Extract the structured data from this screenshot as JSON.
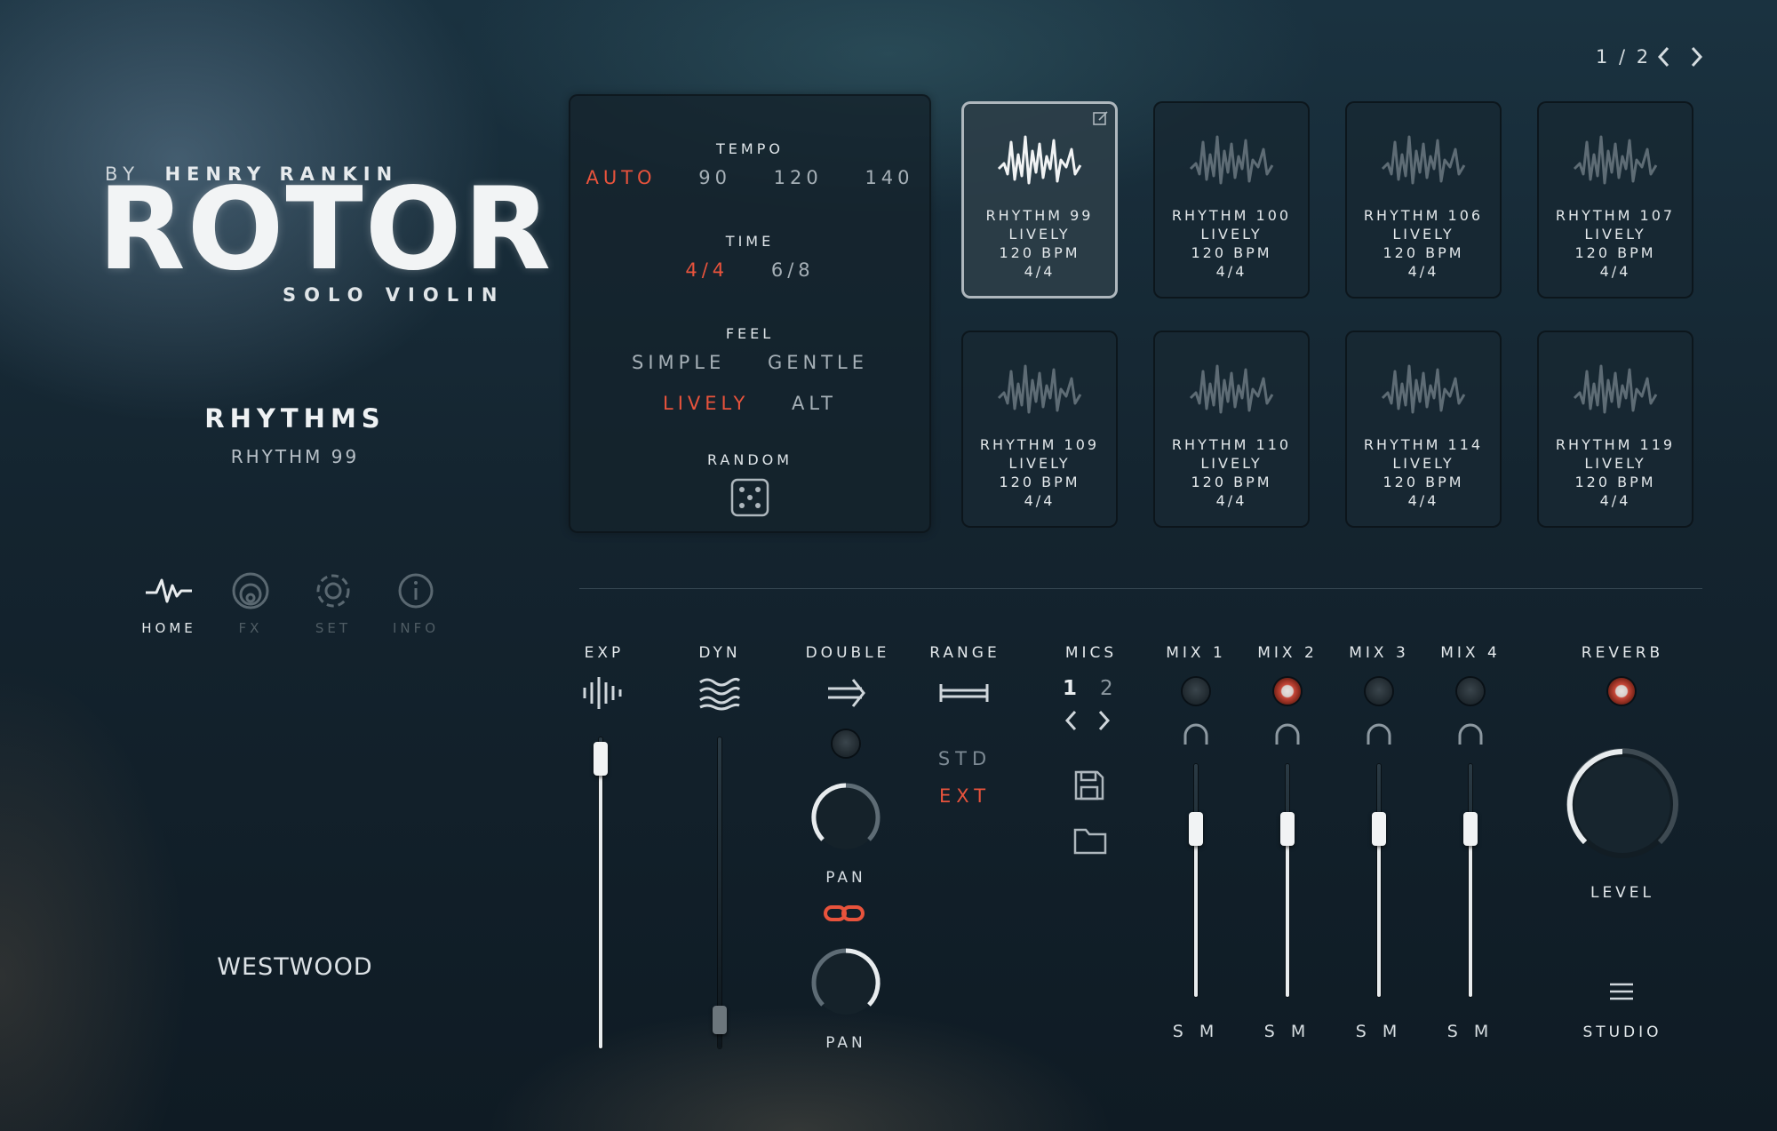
{
  "brand": {
    "by_prefix": "BY",
    "author": "HENRY RANKIN",
    "product": "ROTOR",
    "subtitle": "SOLO VIOLIN",
    "company": "WESTWOOD"
  },
  "section": {
    "title": "RHYTHMS",
    "current": "RHYTHM 99"
  },
  "nav": [
    {
      "label": "HOME",
      "icon": "waveform-icon",
      "active": true
    },
    {
      "label": "FX",
      "icon": "fx-icon",
      "active": false
    },
    {
      "label": "SET",
      "icon": "gear-icon",
      "active": false
    },
    {
      "label": "INFO",
      "icon": "info-icon",
      "active": false
    }
  ],
  "options": {
    "tempo": {
      "label": "TEMPO",
      "items": [
        "AUTO",
        "90",
        "120",
        "140"
      ],
      "selected": "AUTO"
    },
    "time": {
      "label": "TIME",
      "items": [
        "4/4",
        "6/8"
      ],
      "selected": "4/4"
    },
    "feel": {
      "label": "FEEL",
      "items": [
        "SIMPLE",
        "GENTLE",
        "LIVELY",
        "ALT"
      ],
      "selected": "LIVELY"
    },
    "random": {
      "label": "RANDOM",
      "icon": "dice-icon"
    }
  },
  "pager": {
    "text": "1 / 2"
  },
  "rhythms": [
    {
      "name": "RHYTHM 99",
      "feel": "LIVELY",
      "bpm": "120 BPM",
      "meter": "4/4",
      "selected": true
    },
    {
      "name": "RHYTHM 100",
      "feel": "LIVELY",
      "bpm": "120 BPM",
      "meter": "4/4",
      "selected": false
    },
    {
      "name": "RHYTHM 106",
      "feel": "LIVELY",
      "bpm": "120 BPM",
      "meter": "4/4",
      "selected": false
    },
    {
      "name": "RHYTHM 107",
      "feel": "LIVELY",
      "bpm": "120 BPM",
      "meter": "4/4",
      "selected": false
    },
    {
      "name": "RHYTHM 109",
      "feel": "LIVELY",
      "bpm": "120 BPM",
      "meter": "4/4",
      "selected": false
    },
    {
      "name": "RHYTHM 110",
      "feel": "LIVELY",
      "bpm": "120 BPM",
      "meter": "4/4",
      "selected": false
    },
    {
      "name": "RHYTHM 114",
      "feel": "LIVELY",
      "bpm": "120 BPM",
      "meter": "4/4",
      "selected": false
    },
    {
      "name": "RHYTHM 119",
      "feel": "LIVELY",
      "bpm": "120 BPM",
      "meter": "4/4",
      "selected": false
    }
  ],
  "controls": {
    "exp": {
      "label": "EXP",
      "value": 0.97
    },
    "dyn": {
      "label": "DYN",
      "value": 0.05
    },
    "double": {
      "label": "DOUBLE",
      "pan1": "PAN",
      "pan2": "PAN"
    },
    "range": {
      "label": "RANGE",
      "options": [
        "STD",
        "EXT"
      ],
      "selected": "EXT"
    },
    "mics": {
      "label": "MICS",
      "options": [
        "1",
        "2"
      ],
      "selected": "1"
    },
    "mix": [
      {
        "label": "MIX 1",
        "on": false,
        "solo": "S",
        "mute": "M",
        "value": 0.72
      },
      {
        "label": "MIX 2",
        "on": true,
        "solo": "S",
        "mute": "M",
        "value": 0.72
      },
      {
        "label": "MIX 3",
        "on": false,
        "solo": "S",
        "mute": "M",
        "value": 0.72
      },
      {
        "label": "MIX 4",
        "on": false,
        "solo": "S",
        "mute": "M",
        "value": 0.72
      }
    ],
    "reverb": {
      "label": "REVERB",
      "level_label": "LEVEL",
      "on": true,
      "studio_label": "STUDIO"
    }
  },
  "colors": {
    "accent": "#e8533c",
    "text": "#d6dde2",
    "dim": "#7d8a94"
  }
}
